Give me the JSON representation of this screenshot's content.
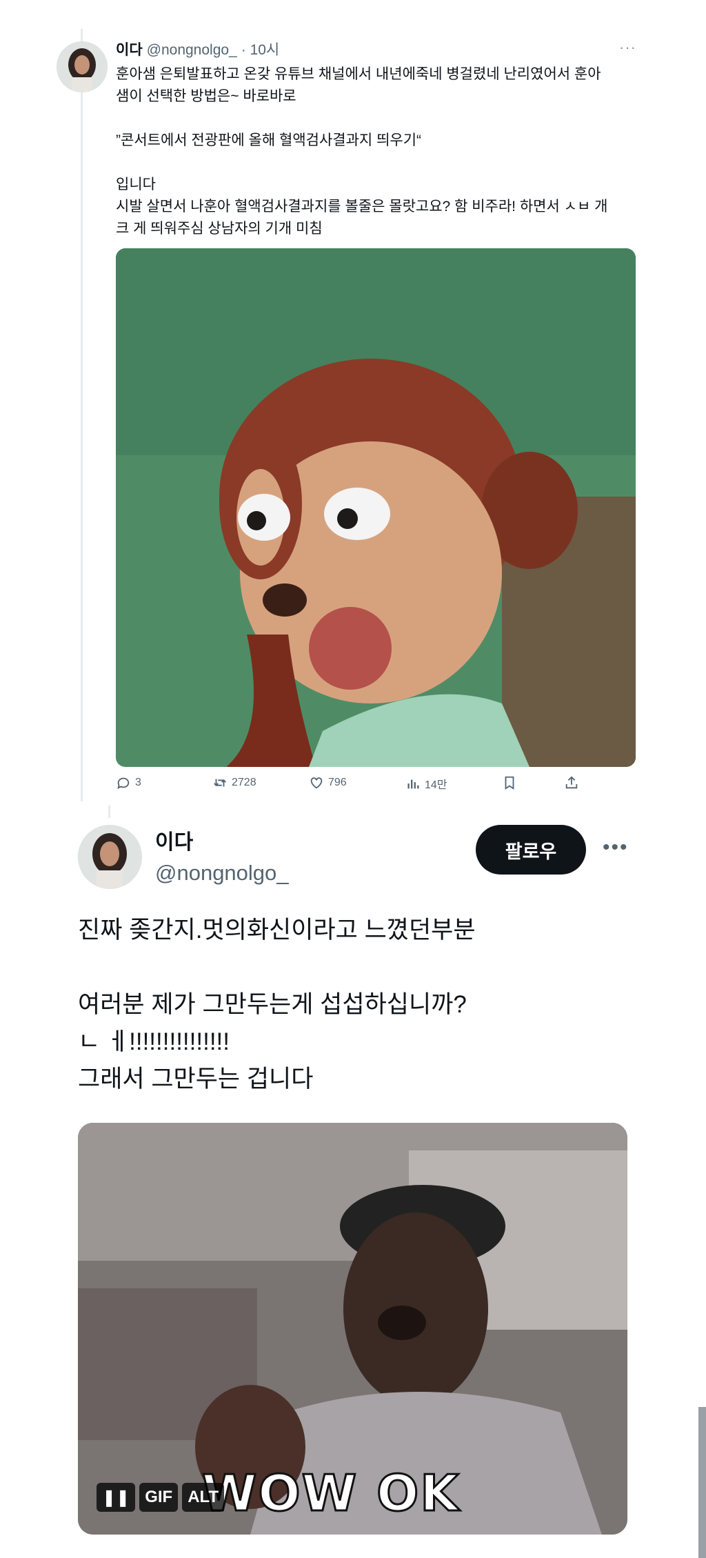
{
  "tweet1": {
    "author_name": "이다",
    "handle": "@nongnolgo_",
    "time": "· 10시",
    "text_lines": [
      "훈아샘 은퇴발표하고 온갖 유튜브 채널에서 내년에죽네 병걸렸네 난리였어서 훈아",
      "샘이 선택한 방법은~ 바로바로",
      "",
      "”콘서트에서 전광판에 올해 혈액검사결과지 띄우기“",
      "",
      "입니다",
      "시발 살면서 나훈아 혈액검사결과지를 볼줄은 몰랏고요? 함 비주라! 하면서 ㅅㅂ 개",
      "크 게 띄워주심 상남자의 기개 미침"
    ],
    "stats": {
      "replies": "3",
      "retweets": "2728",
      "likes": "796",
      "views": "14만"
    }
  },
  "tweet2": {
    "author_name": "이다",
    "handle": "@nongnolgo_",
    "follow_label": "팔로우",
    "text_lines": [
      "진짜 좆간지.멋의화신이라고 느꼈던부분",
      "",
      "여러분 제가 그만두는게 섭섭하십니까?",
      "ㄴ ㅔ!!!!!!!!!!!!!!!",
      "그래서 그만두는 겁니다"
    ],
    "media": {
      "caption": "WOW OK",
      "gif_label": "GIF",
      "alt_label": "ALT"
    }
  },
  "icons": [
    "reply-icon",
    "retweet-icon",
    "like-icon",
    "views-icon",
    "bookmark-icon",
    "share-icon",
    "more-icon",
    "pause-icon"
  ],
  "colors": {
    "secondary_text": "#536471",
    "follow_bg": "#0f1419",
    "thread_line": "#e8eaee"
  }
}
